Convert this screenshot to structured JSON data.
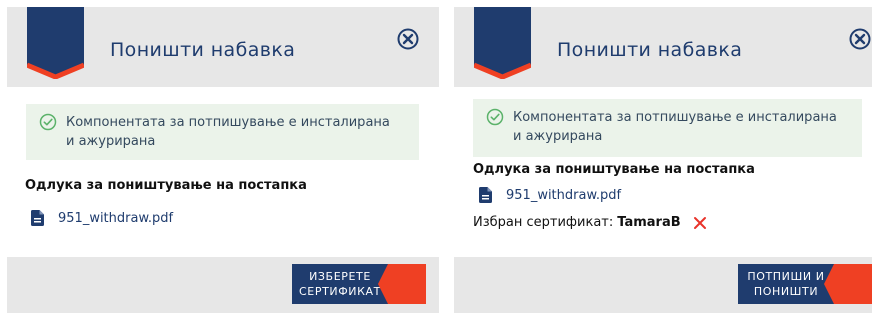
{
  "colors": {
    "navy": "#1f3c6e",
    "accent": "#ef4023",
    "header_bg": "#e7e7e7",
    "notice_bg": "#ebf3ea",
    "success_green": "#5bb26a"
  },
  "left_dialog": {
    "title": "Поништи набавка",
    "notice": "Компонентата за потпишување е инсталирана и ажурирана",
    "section_title": "Одлука за поништување на постапка",
    "file_name": "951_withdraw.pdf",
    "action": {
      "line1": "ИЗБЕРЕТЕ",
      "line2": "СЕРТИФИКАТ"
    }
  },
  "right_dialog": {
    "title": "Поништи набавка",
    "notice": "Компонентата за потпишување е инсталирана и ажурирана",
    "section_title": "Одлука за поништување на постапка",
    "file_name": "951_withdraw.pdf",
    "cert_label": "Избран сертификат:",
    "cert_name": "TamaraB",
    "action": {
      "line1": "ПОТПИШИ И",
      "line2": "ПОНИШТИ"
    }
  },
  "icons": [
    "ribbon-icon",
    "close-circle-icon",
    "check-circle-icon",
    "pdf-file-icon",
    "remove-x-icon",
    "arrow-chevron-icon"
  ]
}
